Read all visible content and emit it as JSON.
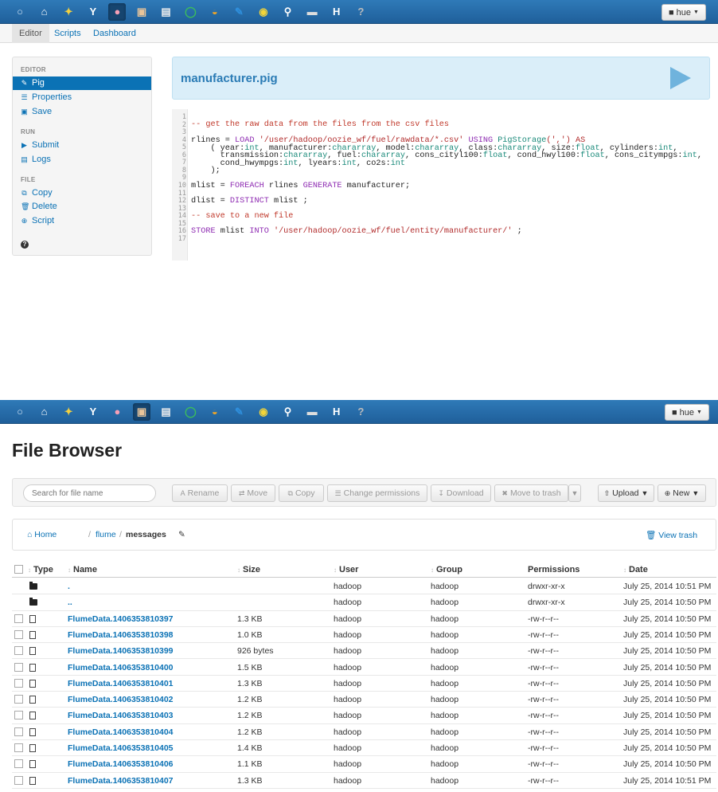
{
  "colors": {
    "navbar": "#1f5f9a",
    "link": "#0b72b5",
    "accent_active": "#0b72b5",
    "title_panel": "#daeef9"
  },
  "navbar": {
    "icons": [
      "hue-logo-icon",
      "home-icon",
      "query-editor-icon",
      "oozie-icon",
      "pig-icon",
      "file-browser-icon",
      "metastore-icon",
      "job-browser-icon",
      "hive-icon",
      "notebook-icon",
      "search-icon",
      "security-icon",
      "shell-icon",
      "hbase-icon",
      "help-icon"
    ],
    "user_label": "hue"
  },
  "pig": {
    "tabs": [
      "Editor",
      "Scripts",
      "Dashboard"
    ],
    "sidebar": {
      "editor_header": "EDITOR",
      "editor_items": [
        "Pig",
        "Properties",
        "Save"
      ],
      "run_header": "RUN",
      "run_items": [
        "Submit",
        "Logs"
      ],
      "file_header": "FILE",
      "file_items": [
        "Copy",
        "Delete",
        "Script"
      ]
    },
    "script_name": "manufacturer.pig",
    "code_line_numbers": [
      "1",
      "2",
      "3",
      "4",
      "5",
      "6",
      "7",
      "8",
      "9",
      "10",
      "11",
      "12",
      "13",
      "14",
      "15",
      "16",
      "17"
    ]
  },
  "file_browser": {
    "title": "File Browser",
    "search_placeholder": "Search for file name",
    "buttons": {
      "rename": "Rename",
      "move": "Move",
      "copy": "Copy",
      "change_permissions": "Change permissions",
      "download": "Download",
      "move_to_trash": "Move to trash",
      "upload": "Upload",
      "new": "New"
    },
    "breadcrumb": {
      "home": "Home",
      "sep": "/",
      "folder": "flume",
      "current": "messages",
      "view_trash": "View trash"
    },
    "columns": {
      "type": "Type",
      "name": "Name",
      "size": "Size",
      "user": "User",
      "group": "Group",
      "permissions": "Permissions",
      "date": "Date"
    },
    "rows": [
      {
        "type": "folder",
        "name": ".",
        "size": "",
        "user": "hadoop",
        "group": "hadoop",
        "permissions": "drwxr-xr-x",
        "date": "July 25, 2014 10:51 PM"
      },
      {
        "type": "folder",
        "name": "..",
        "size": "",
        "user": "hadoop",
        "group": "hadoop",
        "permissions": "drwxr-xr-x",
        "date": "July 25, 2014 10:50 PM"
      },
      {
        "type": "file",
        "name": "FlumeData.1406353810397",
        "size": "1.3 KB",
        "user": "hadoop",
        "group": "hadoop",
        "permissions": "-rw-r--r--",
        "date": "July 25, 2014 10:50 PM"
      },
      {
        "type": "file",
        "name": "FlumeData.1406353810398",
        "size": "1.0 KB",
        "user": "hadoop",
        "group": "hadoop",
        "permissions": "-rw-r--r--",
        "date": "July 25, 2014 10:50 PM"
      },
      {
        "type": "file",
        "name": "FlumeData.1406353810399",
        "size": "926 bytes",
        "user": "hadoop",
        "group": "hadoop",
        "permissions": "-rw-r--r--",
        "date": "July 25, 2014 10:50 PM"
      },
      {
        "type": "file",
        "name": "FlumeData.1406353810400",
        "size": "1.5 KB",
        "user": "hadoop",
        "group": "hadoop",
        "permissions": "-rw-r--r--",
        "date": "July 25, 2014 10:50 PM"
      },
      {
        "type": "file",
        "name": "FlumeData.1406353810401",
        "size": "1.3 KB",
        "user": "hadoop",
        "group": "hadoop",
        "permissions": "-rw-r--r--",
        "date": "July 25, 2014 10:50 PM"
      },
      {
        "type": "file",
        "name": "FlumeData.1406353810402",
        "size": "1.2 KB",
        "user": "hadoop",
        "group": "hadoop",
        "permissions": "-rw-r--r--",
        "date": "July 25, 2014 10:50 PM"
      },
      {
        "type": "file",
        "name": "FlumeData.1406353810403",
        "size": "1.2 KB",
        "user": "hadoop",
        "group": "hadoop",
        "permissions": "-rw-r--r--",
        "date": "July 25, 2014 10:50 PM"
      },
      {
        "type": "file",
        "name": "FlumeData.1406353810404",
        "size": "1.2 KB",
        "user": "hadoop",
        "group": "hadoop",
        "permissions": "-rw-r--r--",
        "date": "July 25, 2014 10:50 PM"
      },
      {
        "type": "file",
        "name": "FlumeData.1406353810405",
        "size": "1.4 KB",
        "user": "hadoop",
        "group": "hadoop",
        "permissions": "-rw-r--r--",
        "date": "July 25, 2014 10:50 PM"
      },
      {
        "type": "file",
        "name": "FlumeData.1406353810406",
        "size": "1.1 KB",
        "user": "hadoop",
        "group": "hadoop",
        "permissions": "-rw-r--r--",
        "date": "July 25, 2014 10:50 PM"
      },
      {
        "type": "file",
        "name": "FlumeData.1406353810407",
        "size": "1.3 KB",
        "user": "hadoop",
        "group": "hadoop",
        "permissions": "-rw-r--r--",
        "date": "July 25, 2014 10:51 PM"
      }
    ]
  },
  "code_text": {
    "l2": "-- get the raw data from the files from the csv files",
    "l4a": "rlines = ",
    "l4b": "LOAD",
    "l4c": " '/user/hadoop/oozie_wf/fuel/rawdata/*.csv'",
    "l4d": " USING ",
    "l4e": "PigStorage",
    "l4f": "(',') AS",
    "l5a": "    ( year:",
    "l5b": "int",
    "l5c": ", manufacturer:",
    "l5d": "chararray",
    "l5e": ", model:",
    "l5f": "chararray",
    "l5g": ", class:",
    "l5h": "chararray",
    "l5i": ", size:",
    "l5j": "float",
    "l5k": ", cylinders:",
    "l5l": "int",
    "l5m": ",",
    "l6a": "      transmission:",
    "l6b": "chararray",
    "l6c": ", fuel:",
    "l6d": "chararray",
    "l6e": ", cons_cityl100:",
    "l6f": "float",
    "l6g": ", cond_hwyl100:",
    "l6h": "float",
    "l6i": ", cons_citympgs:",
    "l6j": "int",
    "l6k": ",",
    "l7a": "      cond_hwympgs:",
    "l7b": "int",
    "l7c": ", lyears:",
    "l7d": "int",
    "l7e": ", co2s:",
    "l7f": "int",
    "l8": "    );",
    "l10a": "mlist = ",
    "l10b": "FOREACH",
    "l10c": " rlines ",
    "l10d": "GENERATE",
    "l10e": " manufacturer;",
    "l12a": "dlist = ",
    "l12b": "DISTINCT",
    "l12c": " mlist ;",
    "l14": "-- save to a new file",
    "l16a": "STORE",
    "l16b": " mlist ",
    "l16c": "INTO",
    "l16d": " '/user/hadoop/oozie_wf/fuel/entity/manufacturer/'",
    "l16e": " ;"
  }
}
